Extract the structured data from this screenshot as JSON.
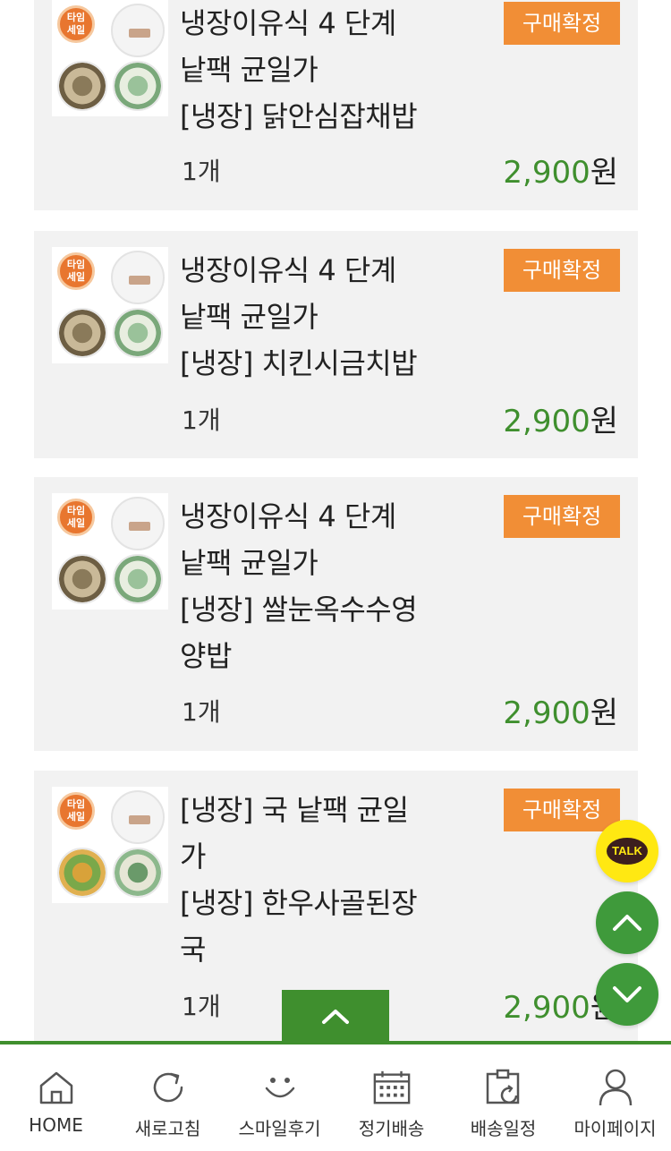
{
  "orders": [
    {
      "title_lines": [
        "냉장이유식 4 단계",
        "낱팩 균일가",
        "[냉장] 닭안심잡채밥"
      ],
      "status": "구매확정",
      "quantity": "1개",
      "price": "2,900",
      "currency": "원",
      "thumb_tag": "타임\n세일"
    },
    {
      "title_lines": [
        "냉장이유식 4 단계",
        "낱팩 균일가",
        "[냉장] 치킨시금치밥"
      ],
      "status": "구매확정",
      "quantity": "1개",
      "price": "2,900",
      "currency": "원",
      "thumb_tag": "타임\n세일"
    },
    {
      "title_lines": [
        "냉장이유식 4 단계",
        "낱팩 균일가",
        "[냉장] 쌀눈옥수수영",
        "양밥"
      ],
      "status": "구매확정",
      "quantity": "1개",
      "price": "2,900",
      "currency": "원",
      "thumb_tag": "타임\n세일"
    },
    {
      "title_lines": [
        "[냉장] 국 낱팩 균일",
        "가",
        "[냉장] 한우사골된장",
        "국"
      ],
      "status": "구매확정",
      "quantity": "1개",
      "price": "2,900",
      "currency": "원",
      "thumb_tag": "타임\n세일"
    }
  ],
  "floating": {
    "talk_label": "TALK"
  },
  "tabbar": {
    "items": [
      {
        "label": "HOME",
        "icon": "home-icon"
      },
      {
        "label": "새로고침",
        "icon": "refresh-icon"
      },
      {
        "label": "스마일후기",
        "icon": "smile-icon"
      },
      {
        "label": "정기배송",
        "icon": "calendar-icon"
      },
      {
        "label": "배송일정",
        "icon": "delivery-schedule-icon"
      },
      {
        "label": "마이페이지",
        "icon": "user-icon"
      }
    ]
  },
  "colors": {
    "accent_green": "#3f8f2e",
    "badge_orange": "#f18e36",
    "kakao_yellow": "#ffe812"
  }
}
